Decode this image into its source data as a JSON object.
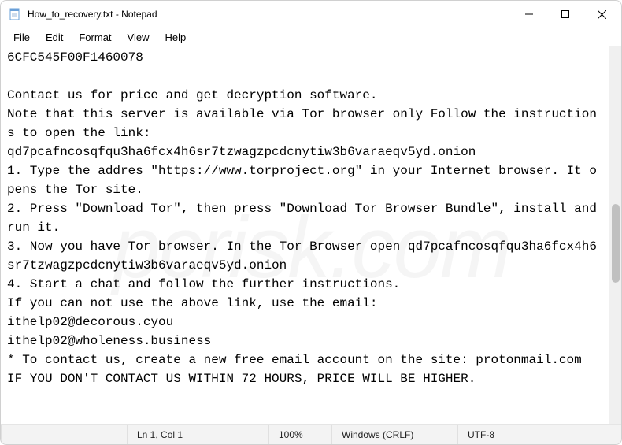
{
  "window": {
    "title": "How_to_recovery.txt - Notepad"
  },
  "menu": {
    "file": "File",
    "edit": "Edit",
    "format": "Format",
    "view": "View",
    "help": "Help"
  },
  "content": "6CFC545F00F1460078\n\nContact us for price and get decryption software.\nNote that this server is available via Tor browser only Follow the instructions to open the link:\nqd7pcafncosqfqu3ha6fcx4h6sr7tzwagzpcdcnytiw3b6varaeqv5yd.onion\n1. Type the addres \"https://www.torproject.org\" in your Internet browser. It opens the Tor site.\n2. Press \"Download Tor\", then press \"Download Tor Browser Bundle\", install and run it.\n3. Now you have Tor browser. In the Tor Browser open qd7pcafncosqfqu3ha6fcx4h6sr7tzwagzpcdcnytiw3b6varaeqv5yd.onion\n4. Start a chat and follow the further instructions.\nIf you can not use the above link, use the email:\nithelp02@decorous.cyou\nithelp02@wholeness.business\n* To contact us, create a new free email account on the site: protonmail.com\nIF YOU DON'T CONTACT US WITHIN 72 HOURS, PRICE WILL BE HIGHER.",
  "status": {
    "lncol": "Ln 1, Col 1",
    "zoom": "100%",
    "line_ending": "Windows (CRLF)",
    "encoding": "UTF-8"
  },
  "watermark": "pcrisk.com"
}
